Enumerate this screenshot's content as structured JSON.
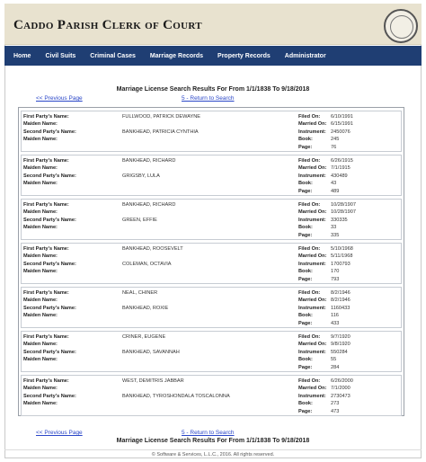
{
  "header": {
    "title": "Caddo Parish Clerk of Court"
  },
  "nav": {
    "items": [
      "Home",
      "Civil Suits",
      "Criminal Cases",
      "Marriage Records",
      "Property Records",
      "Administrator"
    ]
  },
  "results": {
    "title": "Marriage License Search Results For From 1/1/1838 To 9/18/2018",
    "prev_link": "<< Previous Page",
    "return_link": "5 - Return to Search"
  },
  "labels": {
    "first_party": "First Party's Name:",
    "maiden": "Maiden Name:",
    "second_party": "Second Party's Name:",
    "filed_on": "Filed On:",
    "married_on": "Married On:",
    "instrument": "Instrument:",
    "book": "Book:",
    "page": "Page:"
  },
  "records": [
    {
      "first_party": "FULLWOOD, PATRICK DEWAYNE",
      "first_maiden": "",
      "second_party": "BANKHEAD, PATRICIA CYNTHIA",
      "second_maiden": "",
      "filed_on": "6/10/1991",
      "married_on": "6/15/1991",
      "instrument": "2450076",
      "book": "245",
      "page": "76"
    },
    {
      "first_party": "BANKHEAD, RICHARD",
      "first_maiden": "",
      "second_party": "GRIGSBY, LULA",
      "second_maiden": "",
      "filed_on": "6/26/1915",
      "married_on": "7/1/1915",
      "instrument": "430489",
      "book": "43",
      "page": "489"
    },
    {
      "first_party": "BANKHEAD, RICHARD",
      "first_maiden": "",
      "second_party": "GREEN, EFFIE",
      "second_maiden": "",
      "filed_on": "10/28/1907",
      "married_on": "10/28/1907",
      "instrument": "330335",
      "book": "33",
      "page": "335"
    },
    {
      "first_party": "BANKHEAD, ROOSEVELT",
      "first_maiden": "",
      "second_party": "COLEMAN, OCTAVIA",
      "second_maiden": "",
      "filed_on": "5/10/1968",
      "married_on": "5/11/1968",
      "instrument": "1700793",
      "book": "170",
      "page": "793"
    },
    {
      "first_party": "NEAL, CHINER",
      "first_maiden": "",
      "second_party": "BANKHEAD, ROXIE",
      "second_maiden": "",
      "filed_on": "8/2/1946",
      "married_on": "8/2/1946",
      "instrument": "1160433",
      "book": "116",
      "page": "433"
    },
    {
      "first_party": "CRINER, EUGENE",
      "first_maiden": "",
      "second_party": "BANKHEAD, SAVANNAH",
      "second_maiden": "",
      "filed_on": "9/7/1920",
      "married_on": "9/8/1920",
      "instrument": "550284",
      "book": "55",
      "page": "284"
    },
    {
      "first_party": "WEST, DEMITRIS JABBAR",
      "first_maiden": "",
      "second_party": "BANKHEAD, TYROSHONDALA TOSCALONNA",
      "second_maiden": "",
      "filed_on": "6/26/2000",
      "married_on": "7/1/2000",
      "instrument": "2730473",
      "book": "273",
      "page": "473"
    }
  ],
  "footer": {
    "text": "© Software & Services, L.L.C., 2016. All rights reserved."
  }
}
